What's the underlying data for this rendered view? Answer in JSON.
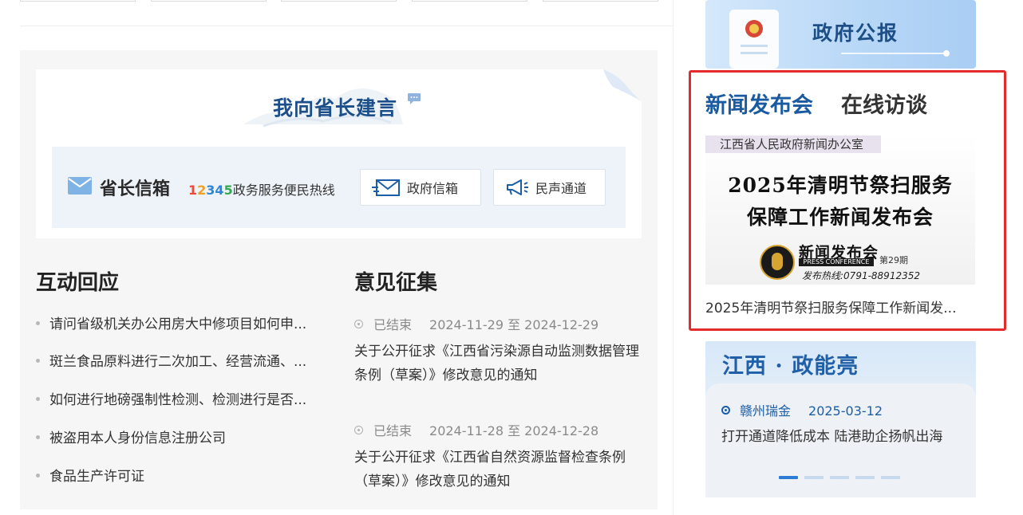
{
  "suggest": {
    "title": "我向省长建言"
  },
  "mailbox": {
    "label": "省长信箱",
    "hotline_digits": [
      "1",
      "2",
      "3",
      "4",
      "5"
    ],
    "hotline_digit_colors": [
      "#e94c3a",
      "#f0a020",
      "#2f86d6",
      "#2f86d6",
      "#33a852"
    ],
    "hotline_text": "政务服务便民热线",
    "btn_gov": "政府信箱",
    "btn_voice": "民声通道"
  },
  "responses": {
    "title": "互动回应",
    "items": [
      "请问省级机关办公用房大中修项目如何申...",
      "斑兰食品原料进行二次加工、经营流通、...",
      "如何进行地磅强制性检测、检测进行是否...",
      "被盗用本人身份信息注册公司",
      "食品生产许可证"
    ]
  },
  "opinions": {
    "title": "意见征集",
    "items": [
      {
        "status": "已结束",
        "date": "2024-11-29 至 2024-12-29",
        "text": "关于公开征求《江西省污染源自动监测数据管理条例（草案）》修改意见的通知"
      },
      {
        "status": "已结束",
        "date": "2024-11-28 至 2024-12-28",
        "text": "关于公开征求《江西省自然资源监督检查条例（草案）》修改意见的通知"
      }
    ]
  },
  "gazette": {
    "title": "政府公报"
  },
  "press": {
    "tab_press": "新闻发布会",
    "tab_online": "在线访谈",
    "image": {
      "org": "江西省人民政府新闻办公室",
      "line1": "2025年清明节祭扫服务",
      "line2": "保障工作新闻发布会",
      "pc_title": "新闻发布会",
      "pc_sub": "PRESS CONFERENCE",
      "issue": "第29期",
      "hotline": "发布热线:0791-88912352"
    },
    "caption": "2025年清明节祭扫服务保障工作新闻发..."
  },
  "energy": {
    "title": "江西 · 政能亮",
    "source": "赣州瑞金",
    "date": "2025-03-12",
    "text": "打开通道降低成本 陆港助企扬帆出海",
    "pager_count": 5,
    "pager_active": 0
  },
  "colors": {
    "brand_blue": "#1a5aa0",
    "highlight_red": "#e32b2b"
  }
}
